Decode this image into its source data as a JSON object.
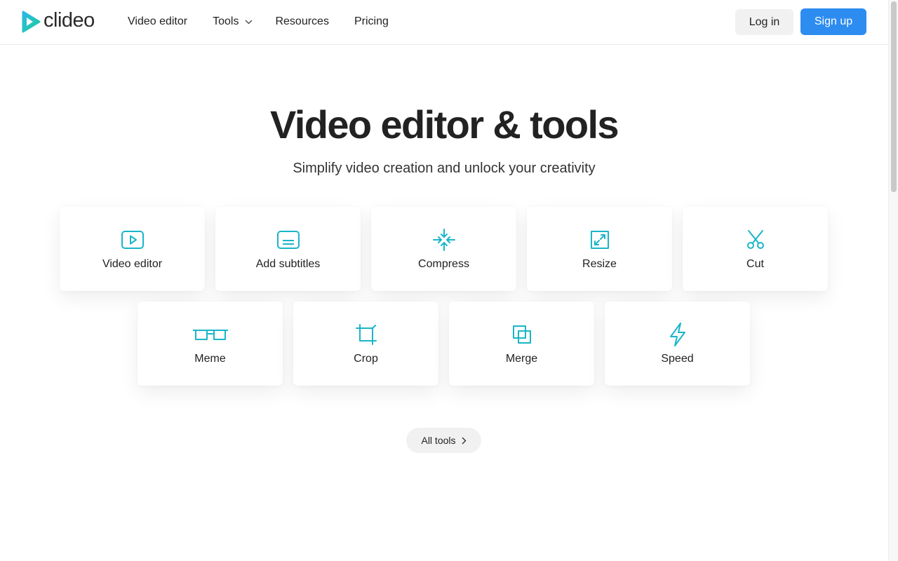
{
  "brand": {
    "name": "clideo",
    "accent": "#1ab5c8",
    "primary": "#2d8cf0"
  },
  "nav": [
    {
      "label": "Video editor"
    },
    {
      "label": "Tools",
      "has_dropdown": true
    },
    {
      "label": "Resources"
    },
    {
      "label": "Pricing"
    }
  ],
  "auth": {
    "login_label": "Log in",
    "signup_label": "Sign up"
  },
  "hero": {
    "title": "Video editor & tools",
    "subtitle": "Simplify video creation and unlock your creativity"
  },
  "tools": [
    {
      "label": "Video editor",
      "icon": "play-square-icon"
    },
    {
      "label": "Add subtitles",
      "icon": "subtitles-icon"
    },
    {
      "label": "Compress",
      "icon": "compress-icon"
    },
    {
      "label": "Resize",
      "icon": "resize-icon"
    },
    {
      "label": "Cut",
      "icon": "scissors-icon"
    },
    {
      "label": "Meme",
      "icon": "glasses-icon"
    },
    {
      "label": "Crop",
      "icon": "crop-icon"
    },
    {
      "label": "Merge",
      "icon": "merge-icon"
    },
    {
      "label": "Speed",
      "icon": "lightning-icon"
    }
  ],
  "all_tools": {
    "label": "All tools"
  }
}
